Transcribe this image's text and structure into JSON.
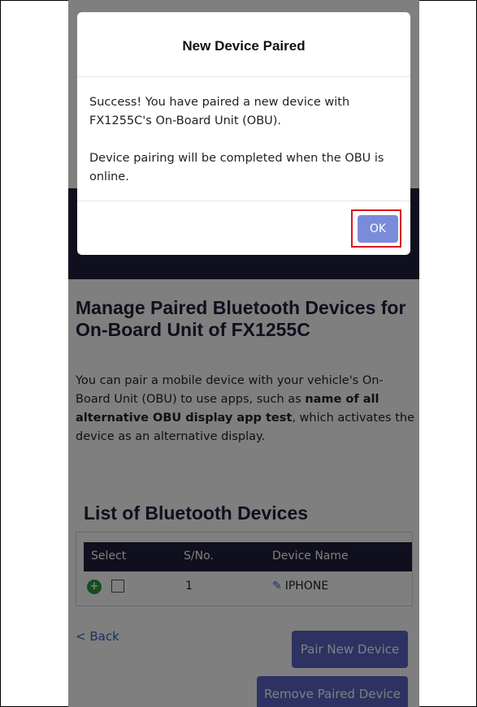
{
  "page": {
    "title": "Manage Paired Bluetooth Devices for On-Board Unit of FX1255C",
    "description_prefix": "You can pair a mobile device with your vehicle's On-Board Unit (OBU) to use apps, such as ",
    "description_bold": "name of all alternative OBU display app test",
    "description_suffix": ", which activates the device as an alternative display.",
    "list_title": "List of Bluetooth Devices",
    "table": {
      "headers": [
        "Select",
        "S/No.",
        "Device Name"
      ],
      "rows": [
        {
          "sno": "1",
          "device_name": "IPHONE"
        }
      ]
    },
    "back_label": "< Back",
    "pair_button": "Pair New Device",
    "remove_button": "Remove Paired Device"
  },
  "modal": {
    "title": "New Device Paired",
    "message1": "Success! You have paired a new device with FX1255C's On-Board Unit (OBU).",
    "message2": "Device pairing will be completed when the OBU is online.",
    "ok_label": "OK"
  },
  "icons": {
    "add": "plus-circle-icon",
    "edit": "edit-icon"
  },
  "colors": {
    "header": "#1e1f3d",
    "primary": "#5b65c6",
    "ok": "#7a8bd9",
    "highlight": "#d9151b",
    "link": "#2f64c8"
  }
}
